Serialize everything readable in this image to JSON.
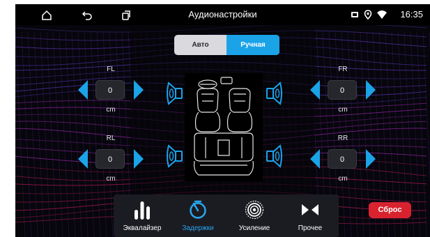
{
  "statusbar": {
    "title": "Аудионастройки",
    "time": "16:35"
  },
  "mode": {
    "auto_label": "Авто",
    "manual_label": "Ручная",
    "selected": "Ручная"
  },
  "channels": {
    "fl": {
      "name": "FL",
      "value": "0",
      "unit": "cm"
    },
    "fr": {
      "name": "FR",
      "value": "0",
      "unit": "cm"
    },
    "rl": {
      "name": "RL",
      "value": "0",
      "unit": "cm"
    },
    "rr": {
      "name": "RR",
      "value": "0",
      "unit": "cm"
    }
  },
  "nav": {
    "items": [
      {
        "label": "Эквалайзер",
        "icon": "equalizer-icon"
      },
      {
        "label": "Задержки",
        "icon": "timer-icon",
        "active": true
      },
      {
        "label": "Усиление",
        "icon": "amplifier-icon"
      },
      {
        "label": "Прочее",
        "icon": "bowtie-icon"
      }
    ]
  },
  "reset_label": "Сброс",
  "colors": {
    "accent": "#1ba3e8",
    "reset": "#d8232f",
    "background": "#06060c"
  }
}
